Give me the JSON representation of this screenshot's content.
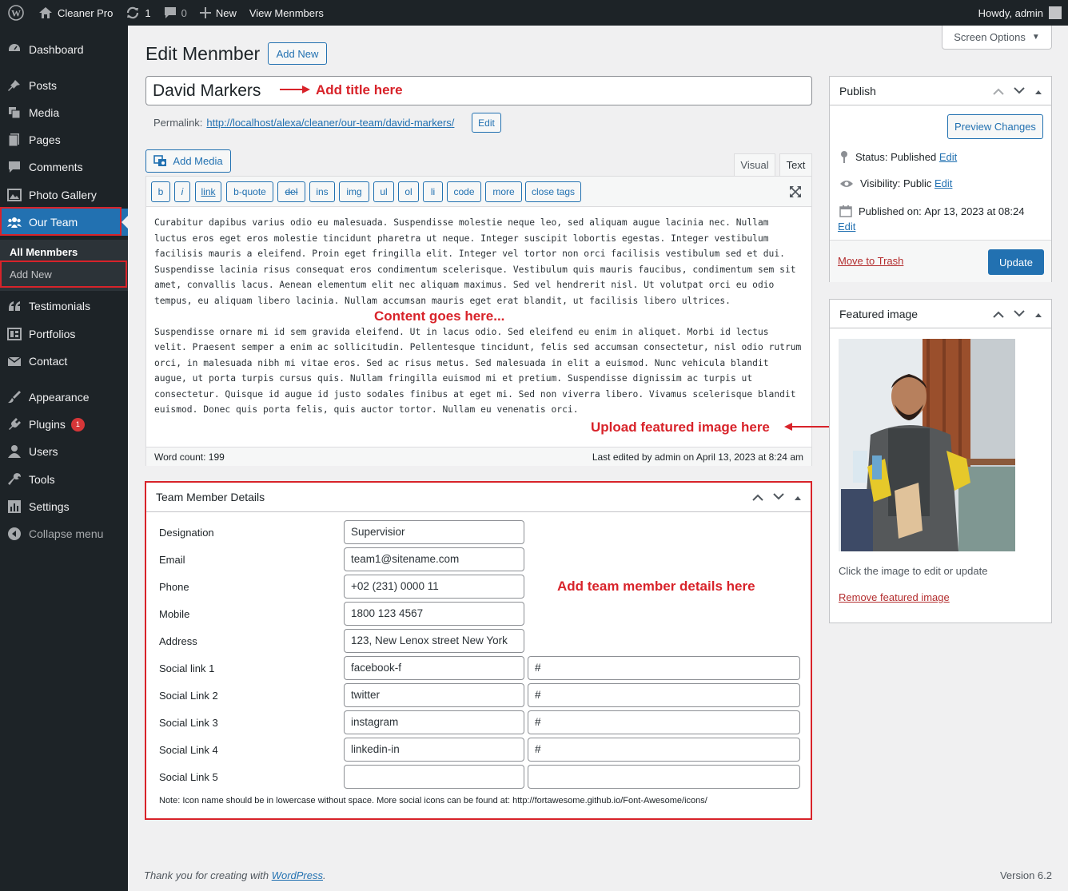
{
  "adminbar": {
    "site_name": "Cleaner Pro",
    "updates_count": "1",
    "comments_count": "0",
    "new_label": "New",
    "view_label": "View Menmbers",
    "greeting": "Howdy, admin"
  },
  "sidebar": {
    "items": [
      {
        "label": "Dashboard",
        "icon": "dashboard-icon"
      },
      {
        "label": "Posts",
        "icon": "pin-icon"
      },
      {
        "label": "Media",
        "icon": "media-icon"
      },
      {
        "label": "Pages",
        "icon": "page-icon"
      },
      {
        "label": "Comments",
        "icon": "comment-icon"
      },
      {
        "label": "Photo Gallery",
        "icon": "gallery-icon"
      },
      {
        "label": "Our Team",
        "icon": "groups-icon"
      },
      {
        "label": "Testimonials",
        "icon": "quote-icon"
      },
      {
        "label": "Portfolios",
        "icon": "portfolio-icon"
      },
      {
        "label": "Contact",
        "icon": "email-icon"
      },
      {
        "label": "Appearance",
        "icon": "brush-icon"
      },
      {
        "label": "Plugins",
        "icon": "plugin-icon",
        "badge": "1"
      },
      {
        "label": "Users",
        "icon": "user-icon"
      },
      {
        "label": "Tools",
        "icon": "wrench-icon"
      },
      {
        "label": "Settings",
        "icon": "settings-icon"
      },
      {
        "label": "Collapse menu",
        "icon": "collapse-icon"
      }
    ],
    "submenu": {
      "all": "All Menmbers",
      "add_new": "Add New"
    }
  },
  "header": {
    "title": "Edit Menmber",
    "add_new": "Add New",
    "screen_options": "Screen Options"
  },
  "post": {
    "title": "David Markers",
    "permalink_label": "Permalink:",
    "permalink_base": "http://localhost/alexa/cleaner/our-team/",
    "permalink_slug": "david-markers",
    "permalink_end": "/",
    "edit_label": "Edit"
  },
  "annotations": {
    "title": "Add title here",
    "content": "Content goes here...",
    "image": "Upload featured image here",
    "details": "Add team member details here"
  },
  "editor": {
    "add_media": "Add Media",
    "tab_visual": "Visual",
    "tab_text": "Text",
    "buttons": [
      "b",
      "i",
      "link",
      "b-quote",
      "del",
      "ins",
      "img",
      "ul",
      "ol",
      "li",
      "code",
      "more",
      "close tags"
    ],
    "paragraph1": "Curabitur dapibus varius odio eu malesuada. Suspendisse molestie neque leo, sed aliquam augue lacinia nec. Nullam luctus eros eget eros molestie tincidunt pharetra ut neque. Integer suscipit lobortis egestas. Integer vestibulum facilisis mauris a eleifend. Proin eget fringilla elit. Integer vel tortor non orci facilisis vestibulum sed et dui. Suspendisse lacinia risus consequat eros condimentum scelerisque. Vestibulum quis mauris faucibus, condimentum sem sit amet, convallis lacus. Aenean elementum elit nec aliquam maximus. Sed vel hendrerit nisl. Ut volutpat orci eu odio tempus, eu aliquam libero lacinia. Nullam accumsan mauris eget erat blandit, ut facilisis libero ultrices.",
    "paragraph2": "Suspendisse ornare mi id sem gravida eleifend. Ut in lacus odio. Sed eleifend eu enim in aliquet. Morbi id lectus velit. Praesent semper a enim ac sollicitudin. Pellentesque tincidunt, felis sed accumsan consectetur, nisl odio rutrum orci, in malesuada nibh mi vitae eros. Sed ac risus metus. Sed malesuada in elit a euismod. Nunc vehicula blandit augue, ut porta turpis cursus quis. Nullam fringilla euismod mi et pretium. Suspendisse dignissim ac turpis ut consectetur. Quisque id augue id justo sodales finibus at eget mi. Sed non viverra libero. Vivamus scelerisque blandit euismod. Donec quis porta felis, quis auctor tortor. Nullam eu venenatis orci.",
    "word_count": "Word count: 199",
    "last_edited": "Last edited by admin on April 13, 2023 at 8:24 am"
  },
  "team_details": {
    "title": "Team Member Details",
    "fields": [
      {
        "label": "Designation",
        "value": "Supervisior"
      },
      {
        "label": "Email",
        "value": "team1@sitename.com"
      },
      {
        "label": "Phone",
        "value": "+02 (231) 0000 11"
      },
      {
        "label": "Mobile",
        "value": "1800 123 4567"
      },
      {
        "label": "Address",
        "value": "123, New Lenox street New York"
      }
    ],
    "social": [
      {
        "label": "Social link 1",
        "icon": "facebook-f",
        "url": "#"
      },
      {
        "label": "Social Link 2",
        "icon": "twitter",
        "url": "#"
      },
      {
        "label": "Social Link 3",
        "icon": "instagram",
        "url": "#"
      },
      {
        "label": "Social Link 4",
        "icon": "linkedin-in",
        "url": "#"
      },
      {
        "label": "Social Link 5",
        "icon": "",
        "url": ""
      }
    ],
    "note": "Note: Icon name should be in lowercase without space. More social icons can be found at: http://fortawesome.github.io/Font-Awesome/icons/"
  },
  "publish": {
    "title": "Publish",
    "preview": "Preview Changes",
    "status_label": "Status:",
    "status_value": "Published",
    "visibility_label": "Visibility:",
    "visibility_value": "Public",
    "published_label": "Published on:",
    "published_value": "Apr 13, 2023 at 08:24",
    "edit": "Edit",
    "trash": "Move to Trash",
    "update": "Update"
  },
  "featured": {
    "title": "Featured image",
    "hint": "Click the image to edit or update",
    "remove": "Remove featured image"
  },
  "footer": {
    "thanks_pre": "Thank you for creating with ",
    "thanks_link": "WordPress",
    "thanks_post": ".",
    "version": "Version 6.2"
  },
  "colors": {
    "accent": "#2271b1",
    "annotation_red": "#d8232a",
    "sidebar_bg": "#1d2327"
  }
}
